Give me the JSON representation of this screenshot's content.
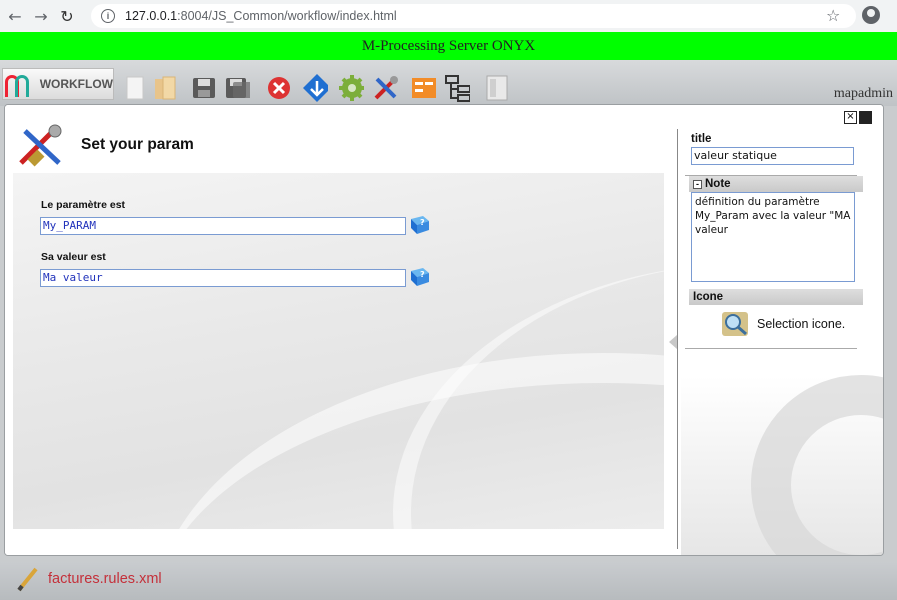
{
  "browser": {
    "url_host": "127.0.0.1",
    "url_path": ":8004/JS_Common/workflow/index.html"
  },
  "banner": {
    "text": "M-Processing Server ONYX",
    "color": "#00ff00"
  },
  "toolbar": {
    "logo_text": "WORKFLOW",
    "user": "mapadmin",
    "tools": [
      "new-doc-icon",
      "open-folder-icon",
      "save-icon",
      "save-as-icon",
      "delete-icon",
      "branch-icon",
      "settings-icon",
      "tools-icon",
      "variables-icon",
      "tree-icon",
      "panel-icon"
    ]
  },
  "dialog": {
    "heading": "Set your param",
    "fields": [
      {
        "label": "Le paramètre est",
        "value": "My_PARAM"
      },
      {
        "label": "Sa valeur est",
        "value": "Ma valeur"
      }
    ]
  },
  "properties": {
    "title_label": "title",
    "title_value": "valeur statique",
    "note_label": "Note",
    "note_value": "définition du paramètre My_Param avec la valeur \"MA valeur",
    "icon_label": "Icone",
    "icon_choice": "Selection icone."
  },
  "footer": {
    "file_name": "factures.rules.xml"
  },
  "colors": {
    "accent_blue": "#1f6fd1",
    "file_red": "#c4303a",
    "input_border": "#7a9bd2"
  }
}
